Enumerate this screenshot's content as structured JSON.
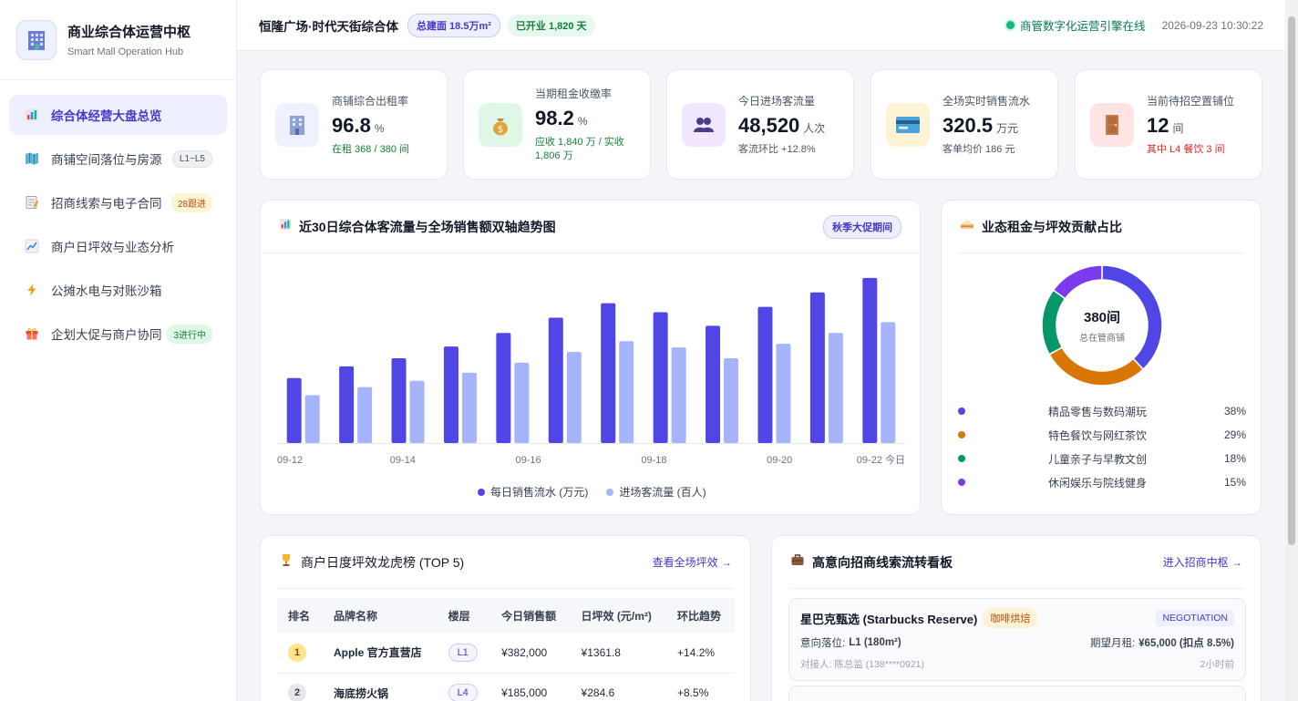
{
  "brand": {
    "title": "商业综合体运营中枢",
    "subtitle": "Smart Mall Operation Hub"
  },
  "nav": [
    {
      "label": "综合体经营大盘总览",
      "icon": "bar-chart-icon",
      "badge": "",
      "active": true
    },
    {
      "label": "商铺空间落位与房源",
      "icon": "map-icon",
      "badge": "L1~L5",
      "badge_style": "gray"
    },
    {
      "label": "招商线索与电子合同",
      "icon": "memo-icon",
      "badge": "28跟进",
      "badge_style": "yellow"
    },
    {
      "label": "商户日坪效与业态分析",
      "icon": "trend-chart-icon",
      "badge": ""
    },
    {
      "label": "公摊水电与对账沙箱",
      "icon": "lightning-icon",
      "badge": ""
    },
    {
      "label": "企划大促与商户协同",
      "icon": "gift-icon",
      "badge": "3进行中",
      "badge_style": "green"
    }
  ],
  "header": {
    "mall_name": "恒隆广场·时代天街综合体",
    "area_chip": "总建面 18.5万m²",
    "opened_chip": "已开业 1,820 天",
    "online_text": "商管数字化运营引擎在线",
    "datetime": "2026-09-23 10:30:22"
  },
  "kpis": [
    {
      "label": "商铺综合出租率",
      "value": "96.8",
      "unit": "%",
      "sub": "在租 368 / 380 间",
      "sub_color": "#15803d",
      "icon": "building-icon",
      "icon_bg": "#eef1ff"
    },
    {
      "label": "当期租金收缴率",
      "value": "98.2",
      "unit": "%",
      "sub": "应收 1,840 万 / 实收 1,806 万",
      "sub_color": "#15803d",
      "icon": "money-bag-icon",
      "icon_bg": "#def7e7"
    },
    {
      "label": "今日进场客流量",
      "value": "48,520",
      "unit": "人次",
      "sub": "客流环比 +12.8%",
      "sub_color": "#4b5563",
      "icon": "people-icon",
      "icon_bg": "#f1e8ff"
    },
    {
      "label": "全场实时销售流水",
      "value": "320.5",
      "unit": "万元",
      "sub": "客单均价 186 元",
      "sub_color": "#4b5563",
      "icon": "credit-card-icon",
      "icon_bg": "#fff3d6"
    },
    {
      "label": "当前待招空置铺位",
      "value": "12",
      "unit": "间",
      "sub": "其中 L4 餐饮 3 间",
      "sub_color": "#dc2626",
      "icon": "door-icon",
      "icon_bg": "#ffe4e4"
    }
  ],
  "trend_panel": {
    "title": "近30日综合体客流量与全场销售额双轴趋势图",
    "tag": "秋季大促期间"
  },
  "share_panel": {
    "title": "业态租金与坪效贡献占比",
    "center_value": "380间",
    "center_label": "总在管商铺"
  },
  "ranking_panel": {
    "title": "商户日度坪效龙虎榜 (TOP 5)",
    "link": "查看全场坪效 →",
    "columns": [
      "排名",
      "品牌名称",
      "楼层",
      "今日销售额",
      "日坪效 (元/m²)",
      "环比趋势"
    ],
    "rows": [
      {
        "rank": "1",
        "brand": "Apple 官方直营店",
        "floor": "L1",
        "sales": "¥382,000",
        "eff": "¥1361.8",
        "trend": "+14.2%"
      },
      {
        "rank": "2",
        "brand": "海底捞火锅",
        "floor": "L4",
        "sales": "¥185,000",
        "eff": "¥284.6",
        "trend": "+8.5%"
      }
    ]
  },
  "leads_panel": {
    "title": "高意向招商线索流转看板",
    "link": "进入招商中枢 →",
    "leads": [
      {
        "name": "星巴克甄选 (Starbucks Reserve)",
        "category": "咖啡烘焙",
        "status": "NEGOTIATION",
        "location_label": "意向落位:",
        "location": "L1 (180m²)",
        "rent_label": "期望月租:",
        "rent": "¥65,000 (扣点 8.5%)",
        "contact": "对接人: 陈总监 (138****0921)",
        "time": "2小时前"
      }
    ]
  },
  "chart_data": [
    {
      "type": "bar",
      "title": "近30日综合体客流量与全场销售额双轴趋势图",
      "categories": [
        "09-12",
        "",
        "09-14",
        "",
        "09-16",
        "",
        "09-18",
        "",
        "09-20",
        "",
        "09-22 今日"
      ],
      "tick_labels": [
        "09-12",
        "09-14",
        "09-16",
        "09-18",
        "09-20",
        "09-22 今日"
      ],
      "series": [
        {
          "name": "每日销售流水 (万元)",
          "color": "#4f46e5",
          "values": [
            72,
            85,
            94,
            107,
            122,
            139,
            155,
            145,
            130,
            151,
            167,
            183
          ]
        },
        {
          "name": "进场客流量 (百人)",
          "color": "#a5b4fc",
          "values": [
            53,
            62,
            69,
            78,
            89,
            101,
            113,
            106,
            94,
            110,
            122,
            134
          ]
        }
      ],
      "ylim": [
        0,
        190
      ]
    },
    {
      "type": "pie",
      "title": "业态租金与坪效贡献占比",
      "categories": [
        "精品零售与数码潮玩",
        "特色餐饮与网红茶饮",
        "儿童亲子与早教文创",
        "休闲娱乐与院线健身"
      ],
      "values": [
        38,
        29,
        18,
        15
      ],
      "labels": [
        "38%",
        "29%",
        "18%",
        "15%"
      ],
      "colors": [
        "#4f46e5",
        "#d97706",
        "#059669",
        "#7c3aed"
      ]
    }
  ]
}
